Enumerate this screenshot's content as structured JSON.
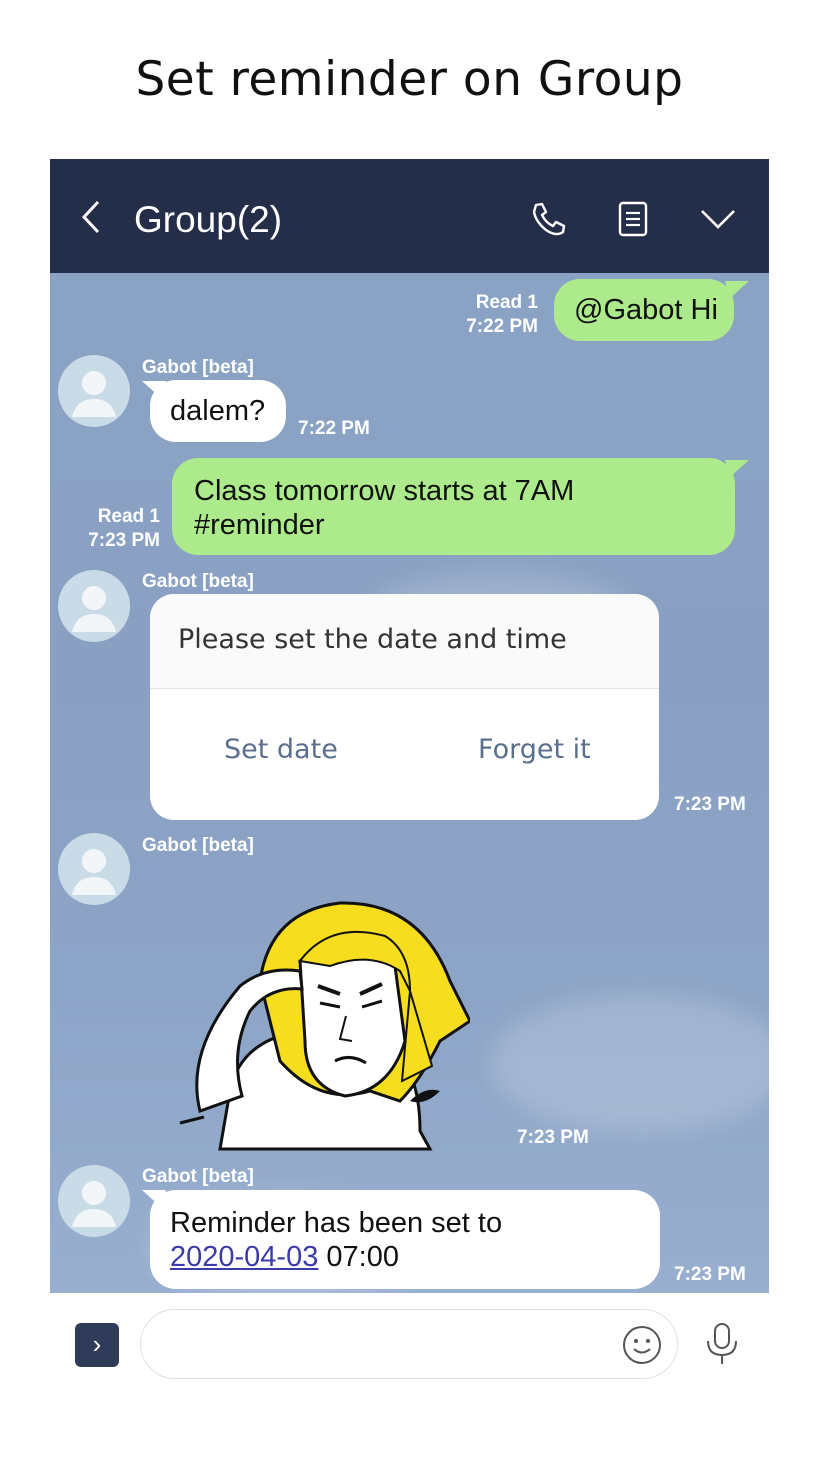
{
  "page_title": "Set reminder on Group",
  "header": {
    "title": "Group(2)"
  },
  "messages": [
    {
      "from": "me",
      "read": "Read 1",
      "time": "7:22 PM",
      "text": "@Gabot Hi"
    },
    {
      "from": "bot",
      "sender": "Gabot [beta]",
      "time": "7:22 PM",
      "text": "dalem?"
    },
    {
      "from": "me",
      "read": "Read 1",
      "time": "7:23 PM",
      "line1": "Class tomorrow starts at 7AM",
      "line2": "#reminder"
    },
    {
      "from": "bot",
      "sender": "Gabot [beta]",
      "time": "7:23 PM",
      "question": "Please set the date and time",
      "btn1": "Set date",
      "btn2": "Forget it"
    },
    {
      "from": "bot",
      "sender": "Gabot [beta]",
      "time": "7:23 PM",
      "type": "sticker"
    },
    {
      "from": "bot",
      "sender": "Gabot [beta]",
      "time": "7:23 PM",
      "line1": "Reminder has been set to",
      "date": "2020-04-03",
      "time_value": " 07:00"
    }
  ],
  "icons": [
    "back-icon",
    "phone-icon",
    "notes-icon",
    "chevron-down-icon",
    "avatar-icon",
    "emoji-icon",
    "mic-icon",
    "expand-icon"
  ],
  "colors": {
    "header": "#252e48",
    "chat_bg": "#8aa3c4",
    "my_bubble": "#adea8c",
    "bot_bubble": "#ffffff"
  }
}
